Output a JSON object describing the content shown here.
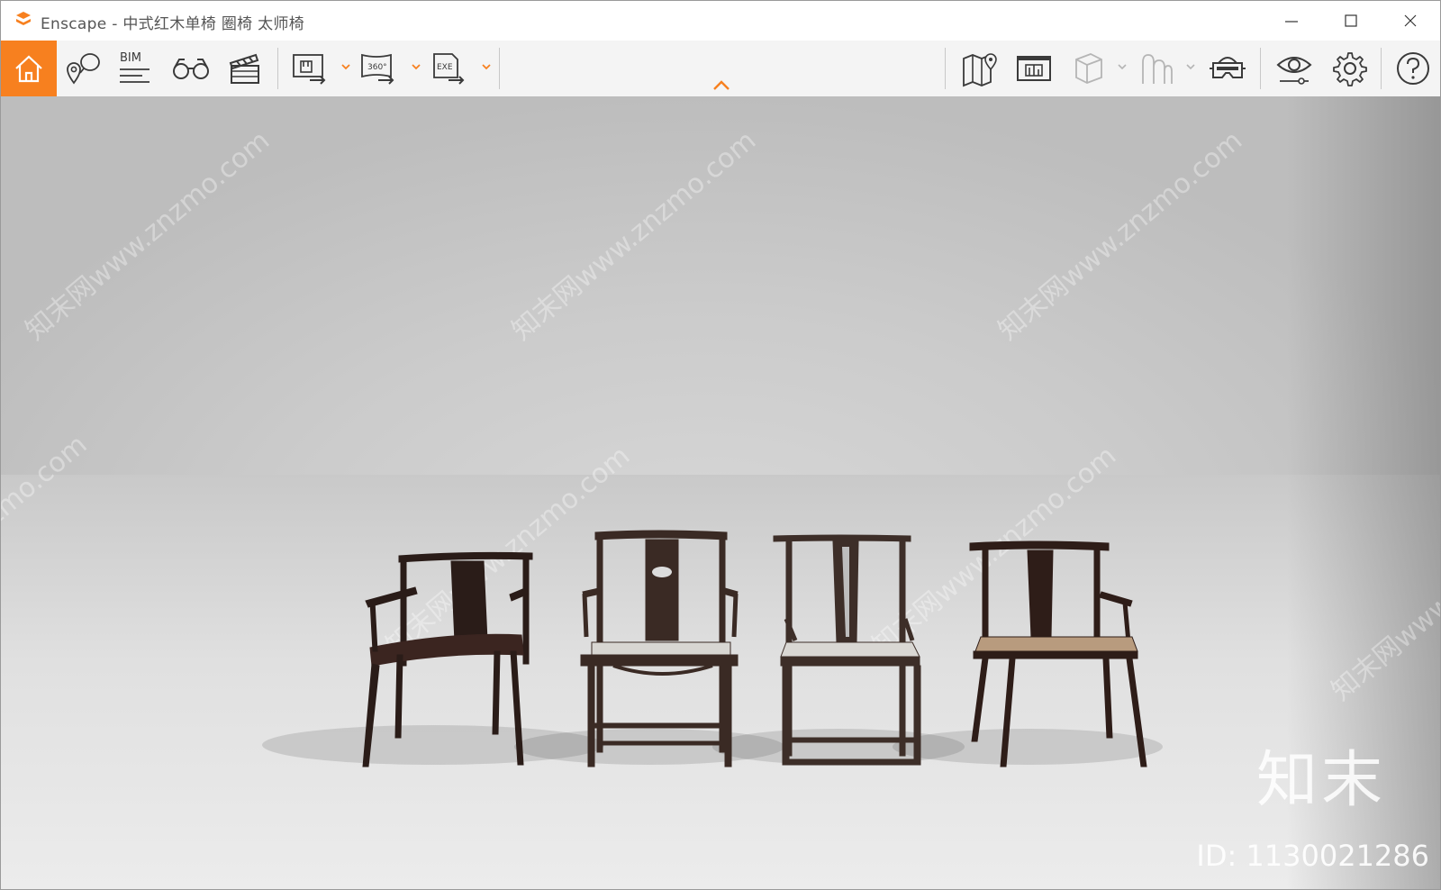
{
  "window": {
    "title": "Enscape - 中式红木单椅 圈椅 太师椅"
  },
  "toolbar": {
    "bim_label": "BIM",
    "view360_label": "360°",
    "exe_label": "EXE"
  },
  "watermark": {
    "text": "知末网www.znzmo.com",
    "text_alt": "znzmo.com",
    "brand": "知末",
    "id_text": "ID: 1130021286"
  },
  "colors": {
    "accent": "#f7801f",
    "icon": "#3a3a3a",
    "icon_disabled": "#b5b5b5"
  },
  "icons": [
    "home-icon",
    "location-pins-icon",
    "bim-icon",
    "binoculars-icon",
    "clapperboard-icon",
    "export-image-icon",
    "export-360-icon",
    "export-exe-icon",
    "map-icon",
    "screenshot-icon",
    "cube-icon",
    "upload-icon",
    "vr-headset-icon",
    "eye-icon",
    "settings-icon",
    "help-icon"
  ]
}
